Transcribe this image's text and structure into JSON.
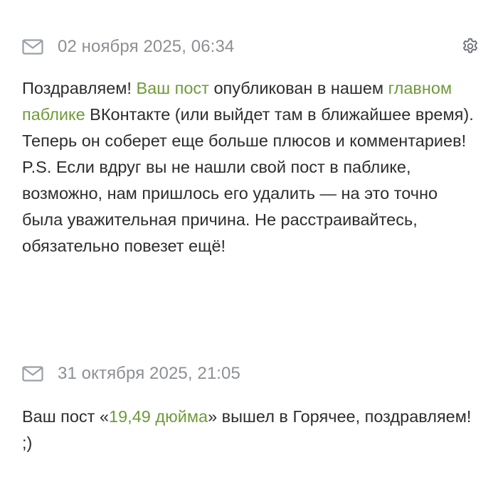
{
  "colors": {
    "link": "#6f9a3a",
    "date": "#8c8f94",
    "text": "#2d2d2d",
    "icon": "#9aa0a6"
  },
  "notifications": [
    {
      "icon": "mail-icon",
      "date": "02 ноября 2025, 06:34",
      "has_settings": true,
      "settings_icon": "gear-icon",
      "text_1": "Поздравляем! ",
      "link_1": "Ваш пост",
      "text_2": " опубликован в нашем ",
      "link_2": "главном паблике",
      "text_3": " ВКонтакте (или выйдет там в ближайшее время). Теперь он соберет еще больше плюсов и комментариев!",
      "text_4": "P.S. Если вдруг вы не нашли свой пост в паблике, возможно, нам пришлось его удалить — на это точно была уважительная причина. Не расстраивайтесь, обязательно повезет ещё!"
    },
    {
      "icon": "mail-icon",
      "date": "31 октября 2025, 21:05",
      "text_1": "Ваш пост «",
      "link_1": "19,49 дюйма",
      "text_2": "» вышел в Горячее, поздравляем! ;)"
    }
  ]
}
